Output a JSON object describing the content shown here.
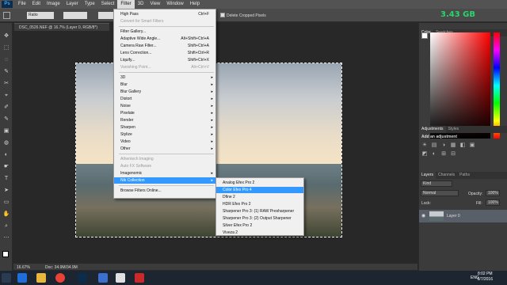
{
  "app": {
    "logo": "Ps"
  },
  "menubar": [
    "File",
    "Edit",
    "Image",
    "Layer",
    "Type",
    "Select",
    "Filter",
    "3D",
    "View",
    "Window",
    "Help"
  ],
  "options": {
    "style_label": "Ratio",
    "delete_cropped": "Delete Cropped Pixels"
  },
  "netspeed": "3.43 GB",
  "document": {
    "tab_title": "DSC_0526.NEF @ 16.7% (Layer 0, RGB/8*)",
    "zoom": "16.67%",
    "doc_size": "Doc: 34.9M/34.9M"
  },
  "filter_menu": {
    "top": [
      {
        "label": "High Pass",
        "shortcut": "Ctrl+F",
        "disabled": false
      },
      {
        "label": "Convert for Smart Filters",
        "shortcut": "",
        "disabled": true
      }
    ],
    "gallery": [
      {
        "label": "Filter Gallery...",
        "shortcut": ""
      },
      {
        "label": "Adaptive Wide Angle...",
        "shortcut": "Alt+Shift+Ctrl+A"
      },
      {
        "label": "Camera Raw Filter...",
        "shortcut": "Shift+Ctrl+A"
      },
      {
        "label": "Lens Correction...",
        "shortcut": "Shift+Ctrl+R"
      },
      {
        "label": "Liquify...",
        "shortcut": "Shift+Ctrl+X"
      },
      {
        "label": "Vanishing Point...",
        "shortcut": "Alt+Ctrl+V",
        "disabled": true
      }
    ],
    "groups": [
      "3D",
      "Blur",
      "Blur Gallery",
      "Distort",
      "Noise",
      "Pixelate",
      "Render",
      "Sharpen",
      "Stylize",
      "Video",
      "Other"
    ],
    "plugins": [
      {
        "label": "Athentech Imaging",
        "disabled": true
      },
      {
        "label": "Auto FX Software",
        "disabled": true
      },
      {
        "label": "Imagenomic",
        "disabled": false
      },
      {
        "label": "Nik Collection",
        "disabled": false
      }
    ],
    "browse": "Browse Filters Online..."
  },
  "nik_submenu": [
    "Analog Efex Pro 2",
    "Color Efex Pro 4",
    "Dfine 2",
    "HDR Efex Pro 2",
    "Sharpener Pro 3: (1) RAW Presharpener",
    "Sharpener Pro 3: (2) Output Sharpener",
    "Silver Efex Pro 2",
    "Viveza 2"
  ],
  "panels": {
    "color_tabs": [
      "Color",
      "Swatches"
    ],
    "adjust_tabs": [
      "Adjustments",
      "Styles"
    ],
    "add_adjustment": "Add an adjustment",
    "layers_tabs": [
      "Layers",
      "Channels",
      "Paths"
    ],
    "kind": "Kind",
    "blend": "Normal",
    "opacity_label": "Opacity:",
    "opacity": "100%",
    "lock_label": "Lock:",
    "fill_label": "Fill:",
    "fill": "100%",
    "layer_name": "Layer 0"
  },
  "taskbar": {
    "time": "8:02 PM",
    "date": "6/7/2016",
    "lang": "ENG"
  },
  "colors": {
    "highlight": "#3399ff",
    "menubar": "#535353",
    "panel": "#3b3b3b",
    "netspeed": "#2bd46a"
  }
}
